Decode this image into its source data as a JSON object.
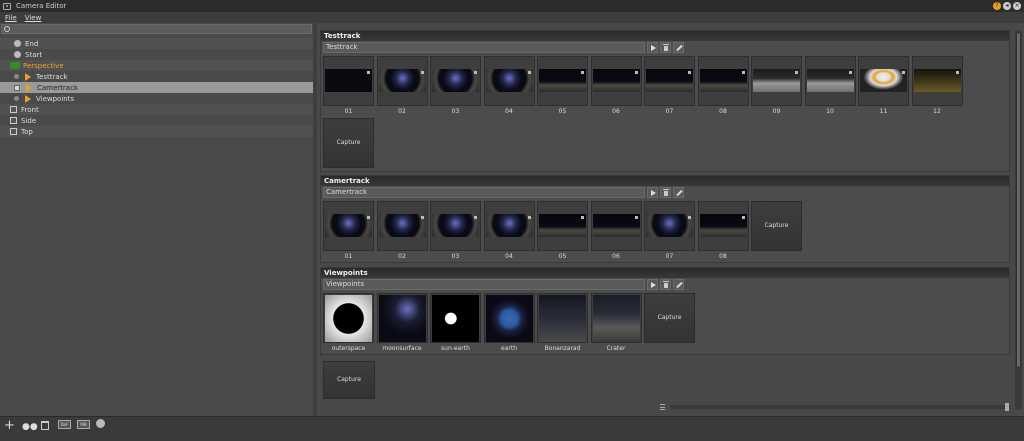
{
  "window": {
    "title": "Camera Editor"
  },
  "menu": {
    "file": "File",
    "view": "View"
  },
  "tree": [
    {
      "label": "End",
      "icon": "dot-icon"
    },
    {
      "label": "Start",
      "icon": "dot-icon"
    },
    {
      "label": "Perspective",
      "icon": "camera-group-icon",
      "highlight": true
    },
    {
      "label": "Testtrack",
      "icon": "play-icon"
    },
    {
      "label": "Camertrack",
      "icon": "play-icon",
      "selected": true
    },
    {
      "label": "Viewpoints",
      "icon": "play-icon"
    },
    {
      "label": "Front",
      "icon": "box-icon"
    },
    {
      "label": "Side",
      "icon": "box-icon"
    },
    {
      "label": "Top",
      "icon": "box-icon"
    }
  ],
  "sections": {
    "testtrack": {
      "title": "Testtrack",
      "field": "Testtrack",
      "thumbs": [
        "01",
        "02",
        "03",
        "04",
        "05",
        "06",
        "07",
        "08",
        "09",
        "10",
        "11",
        "12"
      ],
      "capture": "Capture"
    },
    "camertrack": {
      "title": "Camertrack",
      "field": "Camertrack",
      "thumbs": [
        "01",
        "02",
        "03",
        "04",
        "05",
        "06",
        "07",
        "08"
      ],
      "capture": "Capture"
    },
    "viewpoints": {
      "title": "Viewpoints",
      "field": "Viewpoints",
      "thumbs": [
        "outerspace",
        "moonsurface",
        "sun-earth",
        "earth",
        "Bonanzarad",
        "Crater"
      ],
      "capture": "Capture"
    }
  },
  "extra_capture": "Capture",
  "bottom": {
    "dof": "DoF",
    "mb": "MB"
  },
  "colors": {
    "accent": "#f0a030",
    "selected_row": "#9a9a9a"
  }
}
